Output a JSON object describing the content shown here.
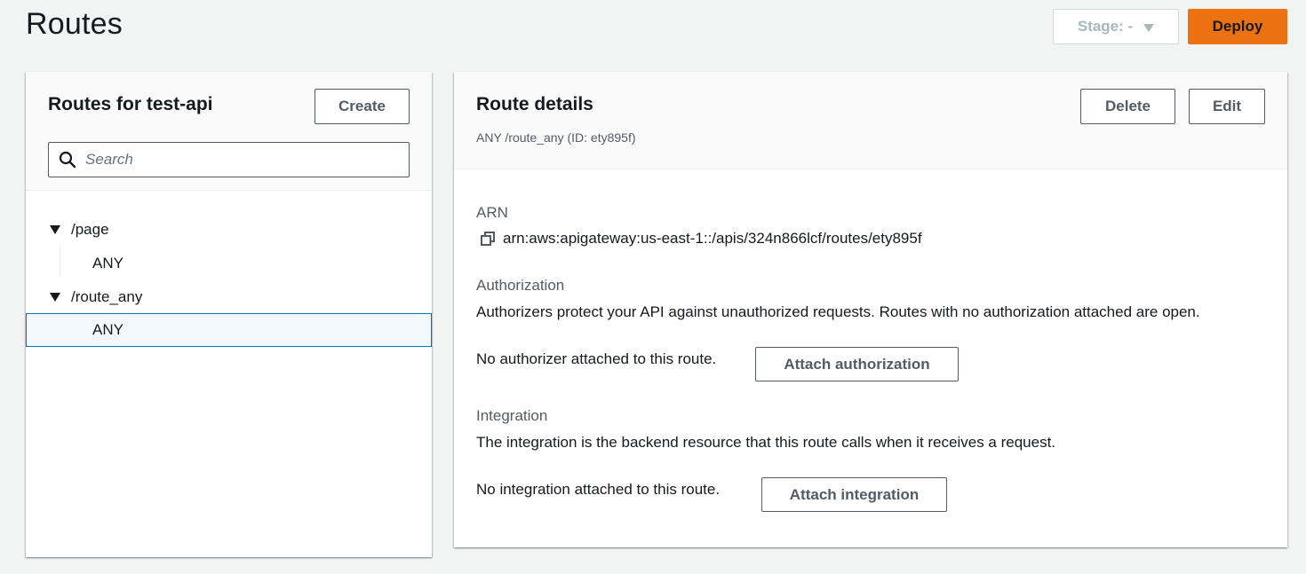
{
  "header": {
    "title": "Routes",
    "stage_label": "Stage: -",
    "deploy_label": "Deploy"
  },
  "routes_panel": {
    "title": "Routes for test-api",
    "create_label": "Create",
    "search_placeholder": "Search",
    "tree": [
      {
        "path": "/page",
        "methods": [
          "ANY"
        ]
      },
      {
        "path": "/route_any",
        "methods": [
          "ANY"
        ]
      }
    ]
  },
  "details_panel": {
    "title": "Route details",
    "subtitle": "ANY /route_any (ID: ety895f)",
    "delete_label": "Delete",
    "edit_label": "Edit",
    "arn_label": "ARN",
    "arn_value": "arn:aws:apigateway:us-east-1::/apis/324n866lcf/routes/ety895f",
    "authorization": {
      "label": "Authorization",
      "description": "Authorizers protect your API against unauthorized requests. Routes with no authorization attached are open.",
      "status": "No authorizer attached to this route.",
      "button_label": "Attach authorization"
    },
    "integration": {
      "label": "Integration",
      "description": "The integration is the backend resource that this route calls when it receives a request.",
      "status": "No integration attached to this route.",
      "button_label": "Attach integration"
    }
  },
  "colors": {
    "accent": "#ec7211",
    "selection_border": "#0073bb",
    "selection_bg": "#f1faff",
    "background": "#f2f3f3"
  }
}
